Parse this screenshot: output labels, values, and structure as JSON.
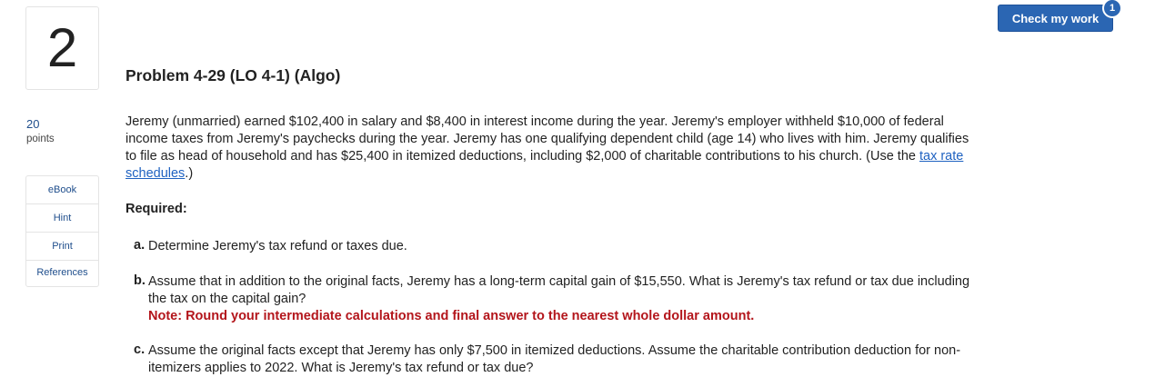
{
  "question": {
    "number": "2",
    "title": "Problem 4-29 (LO 4-1) (Algo)",
    "points_value": "20",
    "points_label": "points"
  },
  "sidebar": {
    "buttons": [
      {
        "label": "eBook"
      },
      {
        "label": "Hint"
      },
      {
        "label": "Print"
      },
      {
        "label": "References"
      }
    ]
  },
  "header": {
    "check_label": "Check my work",
    "badge_count": "1"
  },
  "body": {
    "intro_before_link": "Jeremy (unmarried) earned $102,400 in salary and $8,400 in interest income during the year. Jeremy's employer withheld $10,000 of federal income taxes from Jeremy's paychecks during the year. Jeremy has one qualifying dependent child (age 14) who lives with him. Jeremy qualifies to file as head of household and has $25,400 in itemized deductions, including $2,000 of charitable contributions to his church. (Use the ",
    "link_text": "tax rate schedules",
    "intro_after_link": ".)",
    "required_label": "Required:",
    "parts": [
      {
        "label": "a.",
        "text": "Determine Jeremy's tax refund or taxes due.",
        "note": ""
      },
      {
        "label": "b.",
        "text": "Assume that in addition to the original facts, Jeremy has a long-term capital gain of $15,550. What is Jeremy's tax refund or tax due including the tax on the capital gain?",
        "note": "Note: Round your intermediate calculations and final answer to the nearest whole dollar amount."
      },
      {
        "label": "c.",
        "text": "Assume the original facts except that Jeremy has only $7,500 in itemized deductions. Assume the charitable contribution deduction for non-itemizers applies to 2022. What is Jeremy's tax refund or tax due?",
        "note": ""
      }
    ]
  },
  "colors": {
    "accent": "#2b66b3",
    "link": "#1f62c1",
    "note": "#b3151b"
  }
}
